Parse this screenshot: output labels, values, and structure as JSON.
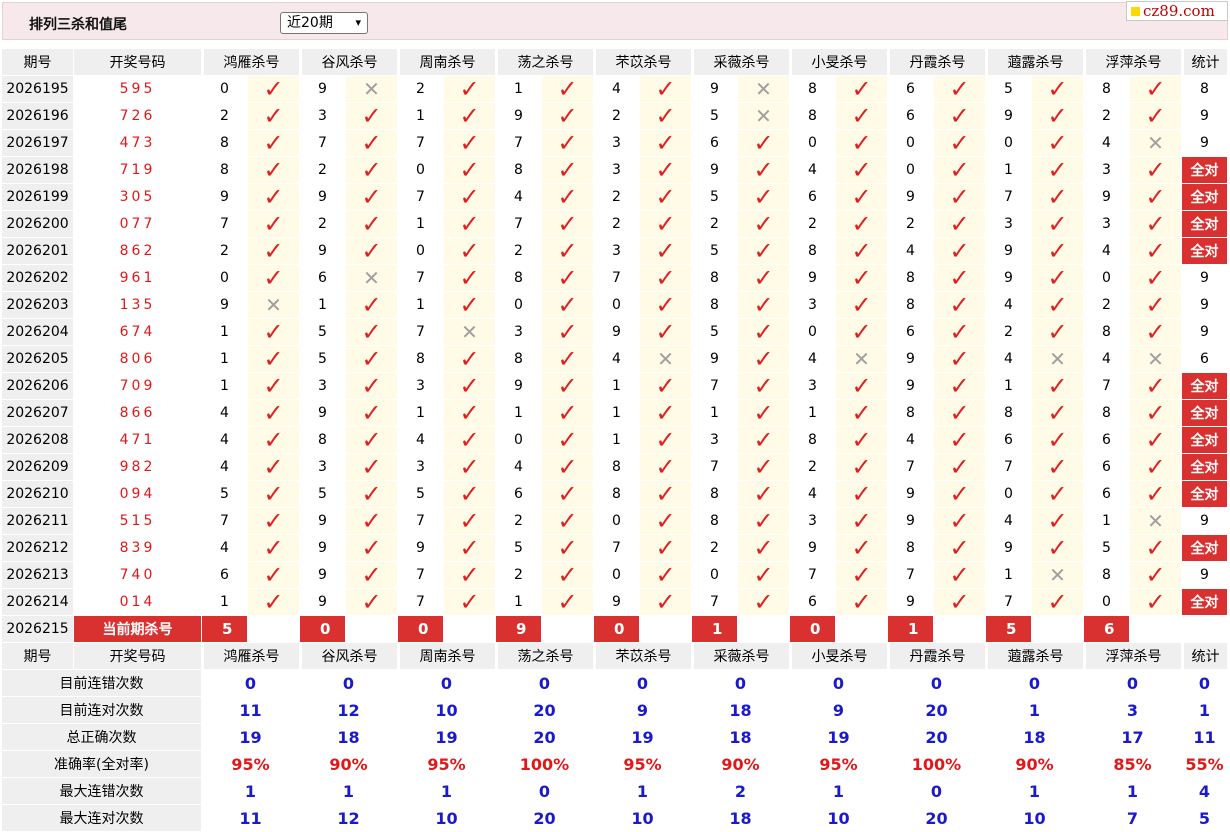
{
  "header": {
    "title": "排列三杀和值尾",
    "period_select": "近20期",
    "brand": "cz89.com"
  },
  "columns": [
    "期号",
    "开奖号码",
    "鸿雁杀号",
    "谷风杀号",
    "周南杀号",
    "荡之杀号",
    "芣苡杀号",
    "采薇杀号",
    "小旻杀号",
    "丹霞杀号",
    "蕸露杀号",
    "浮萍杀号",
    "统计"
  ],
  "rows": [
    {
      "p": "2026195",
      "d": "595",
      "v": [
        "0",
        "9",
        "2",
        "1",
        "4",
        "9",
        "8",
        "6",
        "5",
        "8"
      ],
      "r": [
        1,
        0,
        1,
        1,
        1,
        0,
        1,
        1,
        1,
        1
      ],
      "c": "8"
    },
    {
      "p": "2026196",
      "d": "726",
      "v": [
        "2",
        "3",
        "1",
        "9",
        "2",
        "5",
        "8",
        "6",
        "9",
        "2"
      ],
      "r": [
        1,
        1,
        1,
        1,
        1,
        0,
        1,
        1,
        1,
        1
      ],
      "c": "9"
    },
    {
      "p": "2026197",
      "d": "473",
      "v": [
        "8",
        "7",
        "7",
        "7",
        "3",
        "6",
        "0",
        "0",
        "0",
        "4"
      ],
      "r": [
        1,
        1,
        1,
        1,
        1,
        1,
        1,
        1,
        1,
        0
      ],
      "c": "9"
    },
    {
      "p": "2026198",
      "d": "719",
      "v": [
        "8",
        "2",
        "0",
        "8",
        "3",
        "9",
        "4",
        "0",
        "1",
        "3"
      ],
      "r": [
        1,
        1,
        1,
        1,
        1,
        1,
        1,
        1,
        1,
        1
      ],
      "c": "全对"
    },
    {
      "p": "2026199",
      "d": "305",
      "v": [
        "9",
        "9",
        "7",
        "4",
        "2",
        "5",
        "6",
        "9",
        "7",
        "9"
      ],
      "r": [
        1,
        1,
        1,
        1,
        1,
        1,
        1,
        1,
        1,
        1
      ],
      "c": "全对"
    },
    {
      "p": "2026200",
      "d": "077",
      "v": [
        "7",
        "2",
        "1",
        "7",
        "2",
        "2",
        "2",
        "2",
        "3",
        "3"
      ],
      "r": [
        1,
        1,
        1,
        1,
        1,
        1,
        1,
        1,
        1,
        1
      ],
      "c": "全对"
    },
    {
      "p": "2026201",
      "d": "862",
      "v": [
        "2",
        "9",
        "0",
        "2",
        "3",
        "5",
        "8",
        "4",
        "9",
        "4"
      ],
      "r": [
        1,
        1,
        1,
        1,
        1,
        1,
        1,
        1,
        1,
        1
      ],
      "c": "全对"
    },
    {
      "p": "2026202",
      "d": "961",
      "v": [
        "0",
        "6",
        "7",
        "8",
        "7",
        "8",
        "9",
        "8",
        "9",
        "0"
      ],
      "r": [
        1,
        0,
        1,
        1,
        1,
        1,
        1,
        1,
        1,
        1
      ],
      "c": "9"
    },
    {
      "p": "2026203",
      "d": "135",
      "v": [
        "9",
        "1",
        "1",
        "0",
        "0",
        "8",
        "3",
        "8",
        "4",
        "2"
      ],
      "r": [
        0,
        1,
        1,
        1,
        1,
        1,
        1,
        1,
        1,
        1
      ],
      "c": "9"
    },
    {
      "p": "2026204",
      "d": "674",
      "v": [
        "1",
        "5",
        "7",
        "3",
        "9",
        "5",
        "0",
        "6",
        "2",
        "8"
      ],
      "r": [
        1,
        1,
        0,
        1,
        1,
        1,
        1,
        1,
        1,
        1
      ],
      "c": "9"
    },
    {
      "p": "2026205",
      "d": "806",
      "v": [
        "1",
        "5",
        "8",
        "8",
        "4",
        "9",
        "4",
        "9",
        "4",
        "4"
      ],
      "r": [
        1,
        1,
        1,
        1,
        0,
        1,
        0,
        1,
        0,
        0
      ],
      "c": "6"
    },
    {
      "p": "2026206",
      "d": "709",
      "v": [
        "1",
        "3",
        "3",
        "9",
        "1",
        "7",
        "3",
        "9",
        "1",
        "7"
      ],
      "r": [
        1,
        1,
        1,
        1,
        1,
        1,
        1,
        1,
        1,
        1
      ],
      "c": "全对"
    },
    {
      "p": "2026207",
      "d": "866",
      "v": [
        "4",
        "9",
        "1",
        "1",
        "1",
        "1",
        "1",
        "8",
        "8",
        "8"
      ],
      "r": [
        1,
        1,
        1,
        1,
        1,
        1,
        1,
        1,
        1,
        1
      ],
      "c": "全对"
    },
    {
      "p": "2026208",
      "d": "471",
      "v": [
        "4",
        "8",
        "4",
        "0",
        "1",
        "3",
        "8",
        "4",
        "6",
        "6"
      ],
      "r": [
        1,
        1,
        1,
        1,
        1,
        1,
        1,
        1,
        1,
        1
      ],
      "c": "全对"
    },
    {
      "p": "2026209",
      "d": "982",
      "v": [
        "4",
        "3",
        "3",
        "4",
        "8",
        "7",
        "2",
        "7",
        "7",
        "6"
      ],
      "r": [
        1,
        1,
        1,
        1,
        1,
        1,
        1,
        1,
        1,
        1
      ],
      "c": "全对"
    },
    {
      "p": "2026210",
      "d": "094",
      "v": [
        "5",
        "5",
        "5",
        "6",
        "8",
        "8",
        "4",
        "9",
        "0",
        "6"
      ],
      "r": [
        1,
        1,
        1,
        1,
        1,
        1,
        1,
        1,
        1,
        1
      ],
      "c": "全对"
    },
    {
      "p": "2026211",
      "d": "515",
      "v": [
        "7",
        "9",
        "7",
        "2",
        "0",
        "8",
        "3",
        "9",
        "4",
        "1"
      ],
      "r": [
        1,
        1,
        1,
        1,
        1,
        1,
        1,
        1,
        1,
        0
      ],
      "c": "9"
    },
    {
      "p": "2026212",
      "d": "839",
      "v": [
        "4",
        "9",
        "9",
        "5",
        "7",
        "2",
        "9",
        "8",
        "9",
        "5"
      ],
      "r": [
        1,
        1,
        1,
        1,
        1,
        1,
        1,
        1,
        1,
        1
      ],
      "c": "全对"
    },
    {
      "p": "2026213",
      "d": "740",
      "v": [
        "6",
        "9",
        "7",
        "2",
        "0",
        "0",
        "7",
        "7",
        "1",
        "8"
      ],
      "r": [
        1,
        1,
        1,
        1,
        1,
        1,
        1,
        1,
        0,
        1
      ],
      "c": "9"
    },
    {
      "p": "2026214",
      "d": "014",
      "v": [
        "1",
        "9",
        "7",
        "1",
        "9",
        "7",
        "6",
        "9",
        "7",
        "0"
      ],
      "r": [
        1,
        1,
        1,
        1,
        1,
        1,
        1,
        1,
        1,
        1
      ],
      "c": "全对"
    }
  ],
  "current": {
    "period": "2026215",
    "label": "当前期杀号",
    "values": [
      "5",
      "0",
      "0",
      "9",
      "0",
      "1",
      "0",
      "1",
      "5",
      "6"
    ]
  },
  "stats": [
    {
      "label": "目前连错次数",
      "values": [
        "0",
        "0",
        "0",
        "0",
        "0",
        "0",
        "0",
        "0",
        "0",
        "0",
        "0"
      ]
    },
    {
      "label": "目前连对次数",
      "values": [
        "11",
        "12",
        "10",
        "20",
        "9",
        "18",
        "9",
        "20",
        "1",
        "3",
        "1"
      ]
    },
    {
      "label": "总正确次数",
      "values": [
        "19",
        "18",
        "19",
        "20",
        "19",
        "18",
        "19",
        "20",
        "18",
        "17",
        "11"
      ]
    },
    {
      "label": "准确率(全对率)",
      "values": [
        "95%",
        "90%",
        "95%",
        "100%",
        "95%",
        "90%",
        "95%",
        "100%",
        "90%",
        "85%",
        "55%"
      ],
      "red": true
    },
    {
      "label": "最大连错次数",
      "values": [
        "1",
        "1",
        "1",
        "0",
        "1",
        "2",
        "1",
        "0",
        "1",
        "1",
        "4"
      ]
    },
    {
      "label": "最大连对次数",
      "values": [
        "11",
        "12",
        "10",
        "20",
        "10",
        "18",
        "10",
        "20",
        "10",
        "7",
        "5"
      ]
    }
  ],
  "marks": {
    "ok": "✓",
    "no": "✕"
  },
  "colors": {
    "accent": "#d93030",
    "ok": "#e02020",
    "stat_blue": "#1a1acc",
    "header_bg": "#efefef",
    "mark_bg": "#fffbe6"
  }
}
